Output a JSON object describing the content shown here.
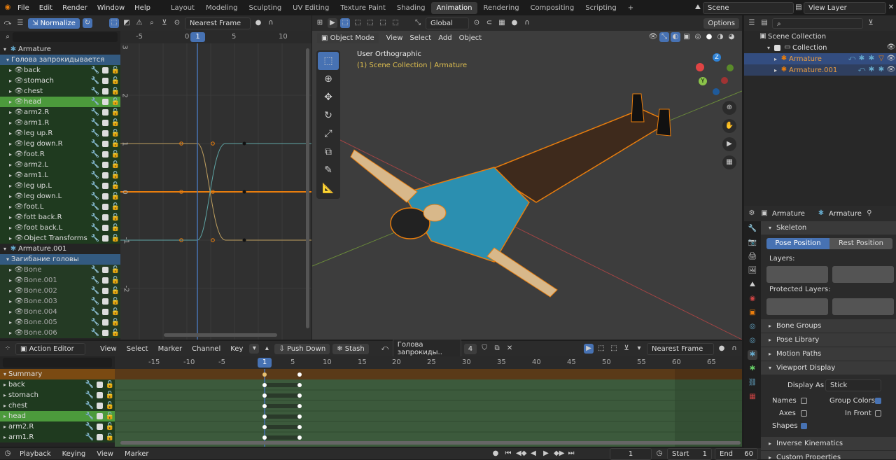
{
  "topbar": {
    "menus": [
      "File",
      "Edit",
      "Render",
      "Window",
      "Help"
    ],
    "workspaces": [
      "Layout",
      "Modeling",
      "Sculpting",
      "UV Editing",
      "Texture Paint",
      "Shading",
      "Animation",
      "Rendering",
      "Compositing",
      "Scripting",
      "+"
    ],
    "active_workspace": "Animation",
    "scene": "Scene",
    "view_layer": "View Layer"
  },
  "graph": {
    "normalize": "Normalize",
    "interp": "Nearest Frame",
    "frame_labels": [
      "-5",
      "0",
      "5",
      "10"
    ],
    "current_frame": "1",
    "y_labels": [
      "3",
      "2",
      "1",
      "0",
      "-1",
      "-2"
    ]
  },
  "channels": [
    {
      "label": "Armature",
      "type": "object"
    },
    {
      "label": "Голова запрокидывается",
      "type": "action"
    },
    {
      "label": "back",
      "type": "bone"
    },
    {
      "label": "stomach",
      "type": "bone"
    },
    {
      "label": "chest",
      "type": "bone"
    },
    {
      "label": "head",
      "type": "bone",
      "selected": true
    },
    {
      "label": "arm2.R",
      "type": "bone"
    },
    {
      "label": "arm1.R",
      "type": "bone"
    },
    {
      "label": "leg up.R",
      "type": "bone"
    },
    {
      "label": "leg down.R",
      "type": "bone"
    },
    {
      "label": "foot.R",
      "type": "bone"
    },
    {
      "label": "arm2.L",
      "type": "bone"
    },
    {
      "label": "arm1.L",
      "type": "bone"
    },
    {
      "label": "leg up.L",
      "type": "bone"
    },
    {
      "label": "leg down.L",
      "type": "bone"
    },
    {
      "label": "foot.L",
      "type": "bone"
    },
    {
      "label": "fott back.R",
      "type": "bone"
    },
    {
      "label": "foot back.L",
      "type": "bone"
    },
    {
      "label": "Object Transforms",
      "type": "bone"
    },
    {
      "label": "Armature.001",
      "type": "object"
    },
    {
      "label": "Загибание головы",
      "type": "action"
    },
    {
      "label": "Bone",
      "type": "bone2"
    },
    {
      "label": "Bone.001",
      "type": "bone2"
    },
    {
      "label": "Bone.002",
      "type": "bone2"
    },
    {
      "label": "Bone.003",
      "type": "bone2"
    },
    {
      "label": "Bone.004",
      "type": "bone2"
    },
    {
      "label": "Bone.005",
      "type": "bone2"
    },
    {
      "label": "Bone.006",
      "type": "bone2"
    }
  ],
  "viewport": {
    "mode": "Object Mode",
    "menus": [
      "View",
      "Select",
      "Add",
      "Object"
    ],
    "orientation": "Global",
    "options": "Options",
    "view_name": "User Orthographic",
    "collection_info": "(1) Scene Collection | Armature"
  },
  "outliner": {
    "items": [
      {
        "label": "Scene Collection",
        "depth": 0
      },
      {
        "label": "Collection",
        "depth": 1
      },
      {
        "label": "Armature",
        "depth": 2,
        "selected": true
      },
      {
        "label": "Armature.001",
        "depth": 2
      }
    ]
  },
  "properties": {
    "breadcrumb": [
      "Armature",
      "Armature"
    ],
    "skeleton": "Skeleton",
    "pose_position": "Pose Position",
    "rest_position": "Rest Position",
    "layers": "Layers:",
    "protected_layers": "Protected Layers:",
    "sections": [
      "Bone Groups",
      "Pose Library",
      "Motion Paths",
      "Viewport Display"
    ],
    "display_as_label": "Display As",
    "display_as_value": "Stick",
    "names": "Names",
    "group_colors": "Group Colors",
    "axes": "Axes",
    "in_front": "In Front",
    "shapes": "Shapes",
    "inverse_kinematics": "Inverse Kinematics",
    "custom_properties": "Custom Properties"
  },
  "action_editor": {
    "mode": "Action Editor",
    "menus": [
      "View",
      "Select",
      "Marker",
      "Channel",
      "Key"
    ],
    "push_down": "Push Down",
    "stash": "Stash",
    "action": "Голова запрокиды..",
    "users": "4",
    "interp": "Nearest Frame",
    "frame_labels": [
      "-15",
      "-10",
      "-5",
      "1",
      "5",
      "10",
      "15",
      "20",
      "25",
      "30",
      "35",
      "40",
      "45",
      "50",
      "55",
      "60",
      "65"
    ],
    "channels": [
      "Summary",
      "back",
      "stomach",
      "chest",
      "head",
      "arm2.R",
      "arm1.R"
    ]
  },
  "timeline": {
    "menus": [
      "Playback",
      "Keying",
      "View",
      "Marker"
    ],
    "frame": "1",
    "start_label": "Start",
    "start": "1",
    "end_label": "End",
    "end": "60"
  }
}
